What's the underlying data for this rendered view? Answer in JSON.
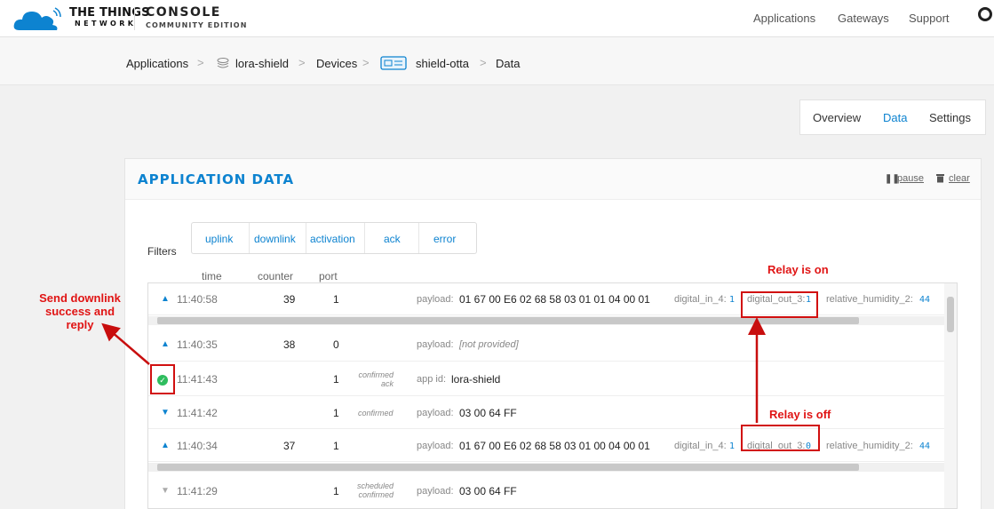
{
  "header": {
    "logo_line1": "THE THINGS",
    "logo_line2": "NETWORK",
    "console_line1": "CONSOLE",
    "console_line2": "COMMUNITY EDITION",
    "nav": [
      "Applications",
      "Gateways",
      "Support"
    ]
  },
  "breadcrumb": {
    "items": [
      "Applications",
      "lora-shield",
      "Devices",
      "shield-otta",
      "Data"
    ],
    "separator": ">"
  },
  "tabs": [
    "Overview",
    "Data",
    "Settings"
  ],
  "active_tab": "Data",
  "panel": {
    "title": "APPLICATION DATA",
    "pause_label": "pause",
    "clear_label": "clear"
  },
  "filters": {
    "label": "Filters",
    "buttons": [
      "uplink",
      "downlink",
      "activation",
      "ack",
      "error"
    ]
  },
  "columns": [
    "time",
    "counter",
    "port"
  ],
  "rows": [
    {
      "time": "11:40:58",
      "counter": "39",
      "port": "1",
      "payload_label": "payload:",
      "payload": "01 67 00 E6 02 68 58 03 01 01 04 00 01",
      "f1": "digital_in_4:",
      "v1": "1",
      "f2": "digital_out_3:",
      "v2": "1",
      "f3": "relative_humidity_2:",
      "v3": "44"
    },
    {
      "time": "11:40:35",
      "counter": "38",
      "port": "0",
      "payload_label": "payload:",
      "payload": "[not provided]"
    },
    {
      "time": "11:41:43",
      "port": "1",
      "tag1": "confirmed",
      "tag2": "ack",
      "app_label": "app id:",
      "app_id": "lora-shield"
    },
    {
      "time": "11:41:42",
      "port": "1",
      "tag1": "confirmed",
      "payload_label": "payload:",
      "payload": "03 00 64 FF"
    },
    {
      "time": "11:40:34",
      "counter": "37",
      "port": "1",
      "payload_label": "payload:",
      "payload": "01 67 00 E6 02 68 58 03 01 00 04 00 01",
      "f1": "digital_in_4:",
      "v1": "1",
      "f2": "digital_out_3:",
      "v2": "0",
      "f3": "relative_humidity_2:",
      "v3": "44"
    },
    {
      "time": "11:41:29",
      "port": "1",
      "tag1": "scheduled",
      "tag2": "confirmed",
      "payload_label": "payload:",
      "payload": "03 00 64 FF"
    }
  ],
  "annotations": {
    "relay_on": "Relay is on",
    "relay_off": "Relay is off",
    "downlink_line1": "Send downlink",
    "downlink_line2": "success and reply"
  },
  "colors": {
    "accent": "#0d83d0",
    "annotation": "#e01414",
    "success": "#2ebd5e"
  }
}
